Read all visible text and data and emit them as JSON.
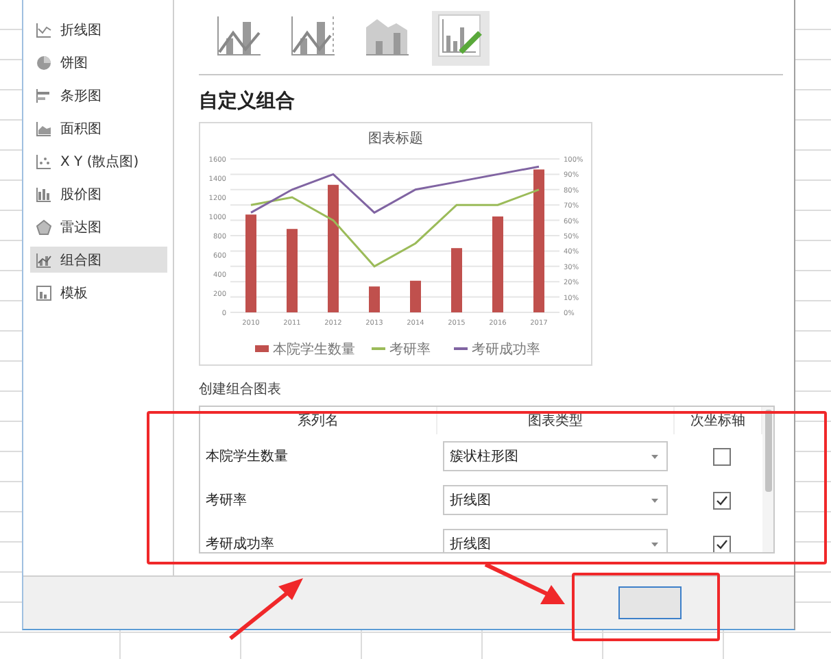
{
  "sidebar": {
    "items": [
      {
        "label": "折线图",
        "kind": "line",
        "selected": false
      },
      {
        "label": "饼图",
        "kind": "pie",
        "selected": false
      },
      {
        "label": "条形图",
        "kind": "bar",
        "selected": false
      },
      {
        "label": "面积图",
        "kind": "area",
        "selected": false
      },
      {
        "label": "X Y (散点图)",
        "kind": "scatter",
        "selected": false
      },
      {
        "label": "股价图",
        "kind": "stock",
        "selected": false
      },
      {
        "label": "雷达图",
        "kind": "radar",
        "selected": false
      },
      {
        "label": "组合图",
        "kind": "combo",
        "selected": true
      },
      {
        "label": "模板",
        "kind": "template",
        "selected": false
      }
    ]
  },
  "subtypes": [
    {
      "kind": "combo-line",
      "selected": false
    },
    {
      "kind": "combo-line-axis",
      "selected": false
    },
    {
      "kind": "combo-area",
      "selected": false
    },
    {
      "kind": "custom",
      "selected": true
    }
  ],
  "section_title": "自定义组合",
  "preview": {
    "chart_data": {
      "type": "bar",
      "title": "图表标题",
      "categories": [
        "2010",
        "2011",
        "2012",
        "2013",
        "2014",
        "2015",
        "2016",
        "2017"
      ],
      "series": [
        {
          "name": "本院学生数量",
          "color": "#c0504d",
          "values": [
            1020,
            870,
            1330,
            270,
            330,
            670,
            1000,
            1490
          ]
        },
        {
          "name": "考研率",
          "type": "line",
          "axis": "y2",
          "color": "#9bbb59",
          "values": [
            0.7,
            0.75,
            0.6,
            0.3,
            0.45,
            0.7,
            0.7,
            0.8
          ]
        },
        {
          "name": "考研成功率",
          "type": "line",
          "axis": "y2",
          "color": "#8064a2",
          "values": [
            0.65,
            0.8,
            0.9,
            0.65,
            0.8,
            0.85,
            0.9,
            0.95
          ]
        }
      ],
      "grid": true,
      "legend": true,
      "ylim": [
        0,
        1600
      ],
      "yticks": [
        0,
        200,
        400,
        600,
        800,
        1000,
        1200,
        1400,
        1600
      ],
      "y2lim": [
        0,
        1
      ],
      "y2ticks": [
        {
          "value": 0,
          "label": "0%"
        },
        {
          "value": 0.1,
          "label": "10%"
        },
        {
          "value": 0.2,
          "label": "20%"
        },
        {
          "value": 0.3,
          "label": "30%"
        },
        {
          "value": 0.4,
          "label": "40%"
        },
        {
          "value": 0.5,
          "label": "50%"
        },
        {
          "value": 0.6,
          "label": "60%"
        },
        {
          "value": 0.7,
          "label": "70%"
        },
        {
          "value": 0.8,
          "label": "80%"
        },
        {
          "value": 0.9,
          "label": "90%"
        },
        {
          "value": 1,
          "label": "100%"
        }
      ]
    }
  },
  "table": {
    "caption": "创建组合图表",
    "columns": [
      "系列名",
      "图表类型",
      "次坐标轴"
    ],
    "rows": [
      {
        "name": "本院学生数量",
        "chart_type": "簇状柱形图",
        "secondary_axis": false
      },
      {
        "name": "考研率",
        "chart_type": "折线图",
        "secondary_axis": true
      },
      {
        "name": "考研成功率",
        "chart_type": "折线图",
        "secondary_axis": true
      }
    ]
  }
}
